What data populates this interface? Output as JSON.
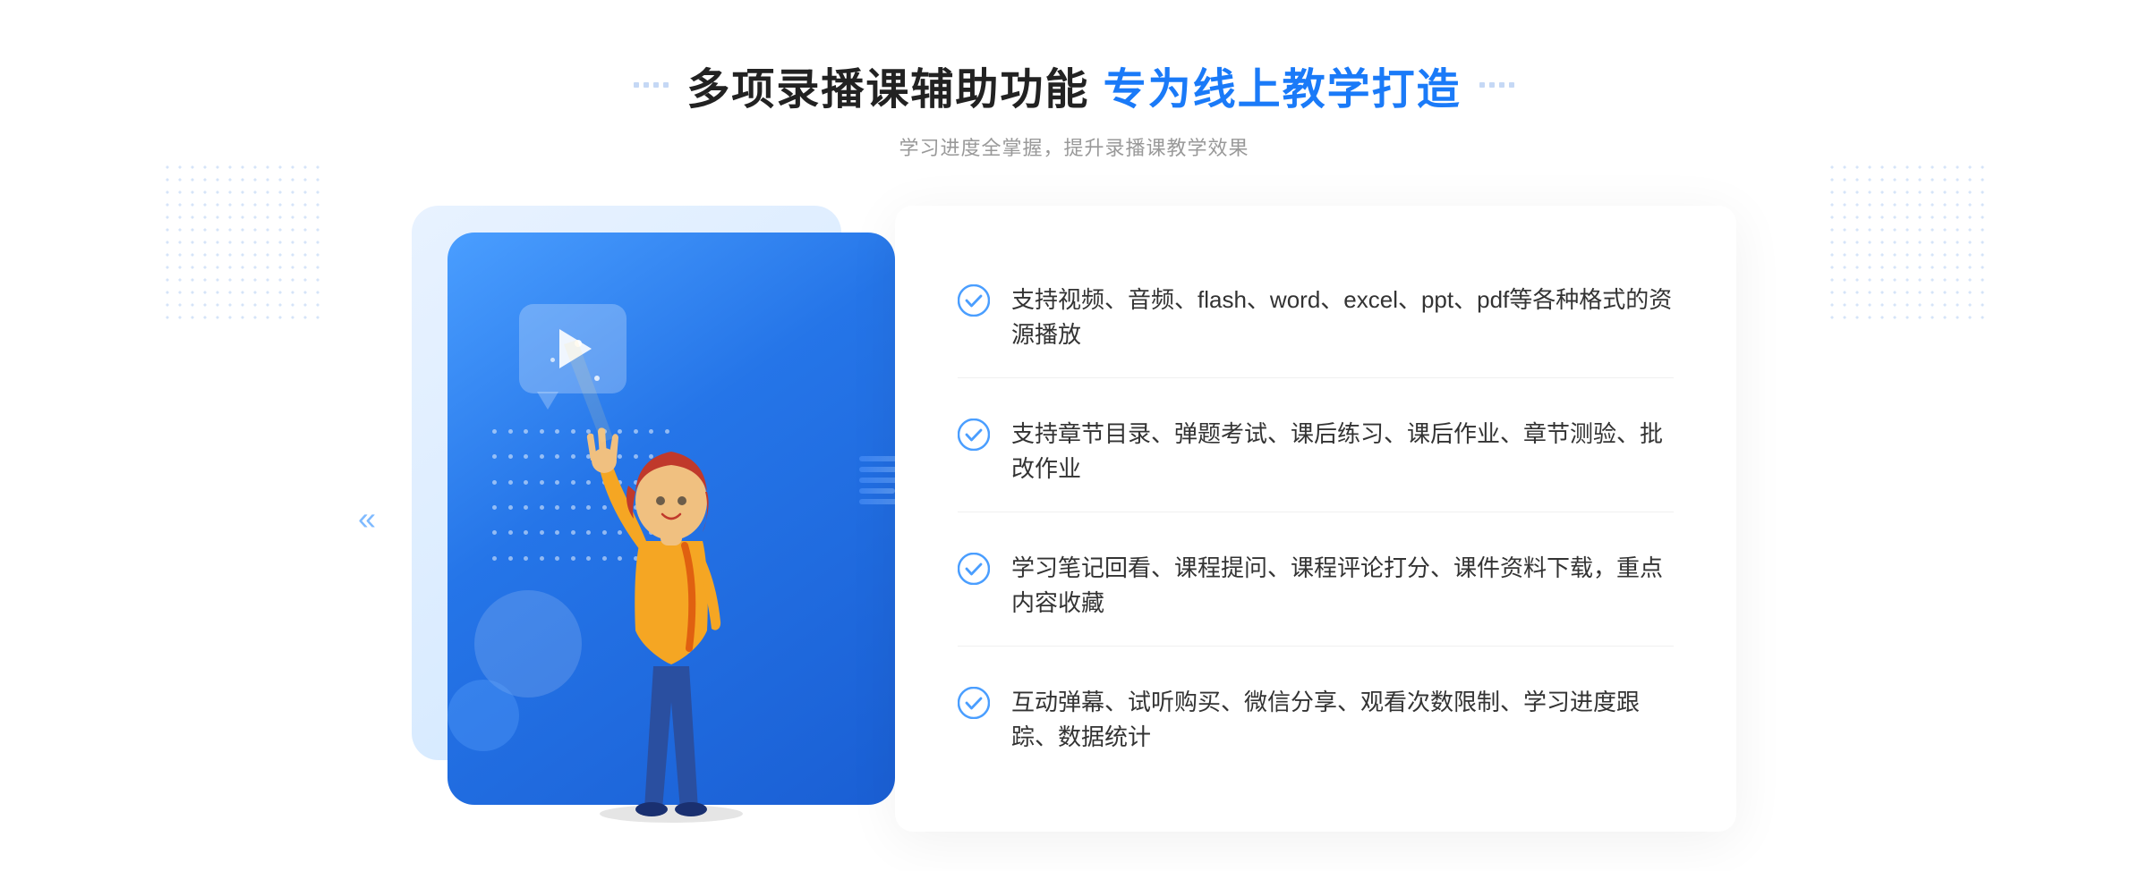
{
  "header": {
    "main_title": "多项录播课辅助功能 专为线上教学打造",
    "subtitle": "学习进度全掌握，提升录播课教学效果",
    "title_part1": "多项录播课辅助功能",
    "title_part2": "专为线上教学打造"
  },
  "features": [
    {
      "id": 1,
      "text": "支持视频、音频、flash、word、excel、ppt、pdf等各种格式的资源播放"
    },
    {
      "id": 2,
      "text": "支持章节目录、弹题考试、课后练习、课后作业、章节测验、批改作业"
    },
    {
      "id": 3,
      "text": "学习笔记回看、课程提问、课程评论打分、课件资料下载，重点内容收藏"
    },
    {
      "id": 4,
      "text": "互动弹幕、试听购买、微信分享、观看次数限制、学习进度跟踪、数据统计"
    }
  ],
  "colors": {
    "primary_blue": "#2575e8",
    "light_blue": "#d0e7ff",
    "accent": "#4a9eff",
    "text_dark": "#333333",
    "text_gray": "#999999",
    "check_color": "#4a9eff"
  },
  "icons": {
    "check": "check-circle",
    "play": "play-triangle",
    "chevron_left": "chevron-left"
  }
}
